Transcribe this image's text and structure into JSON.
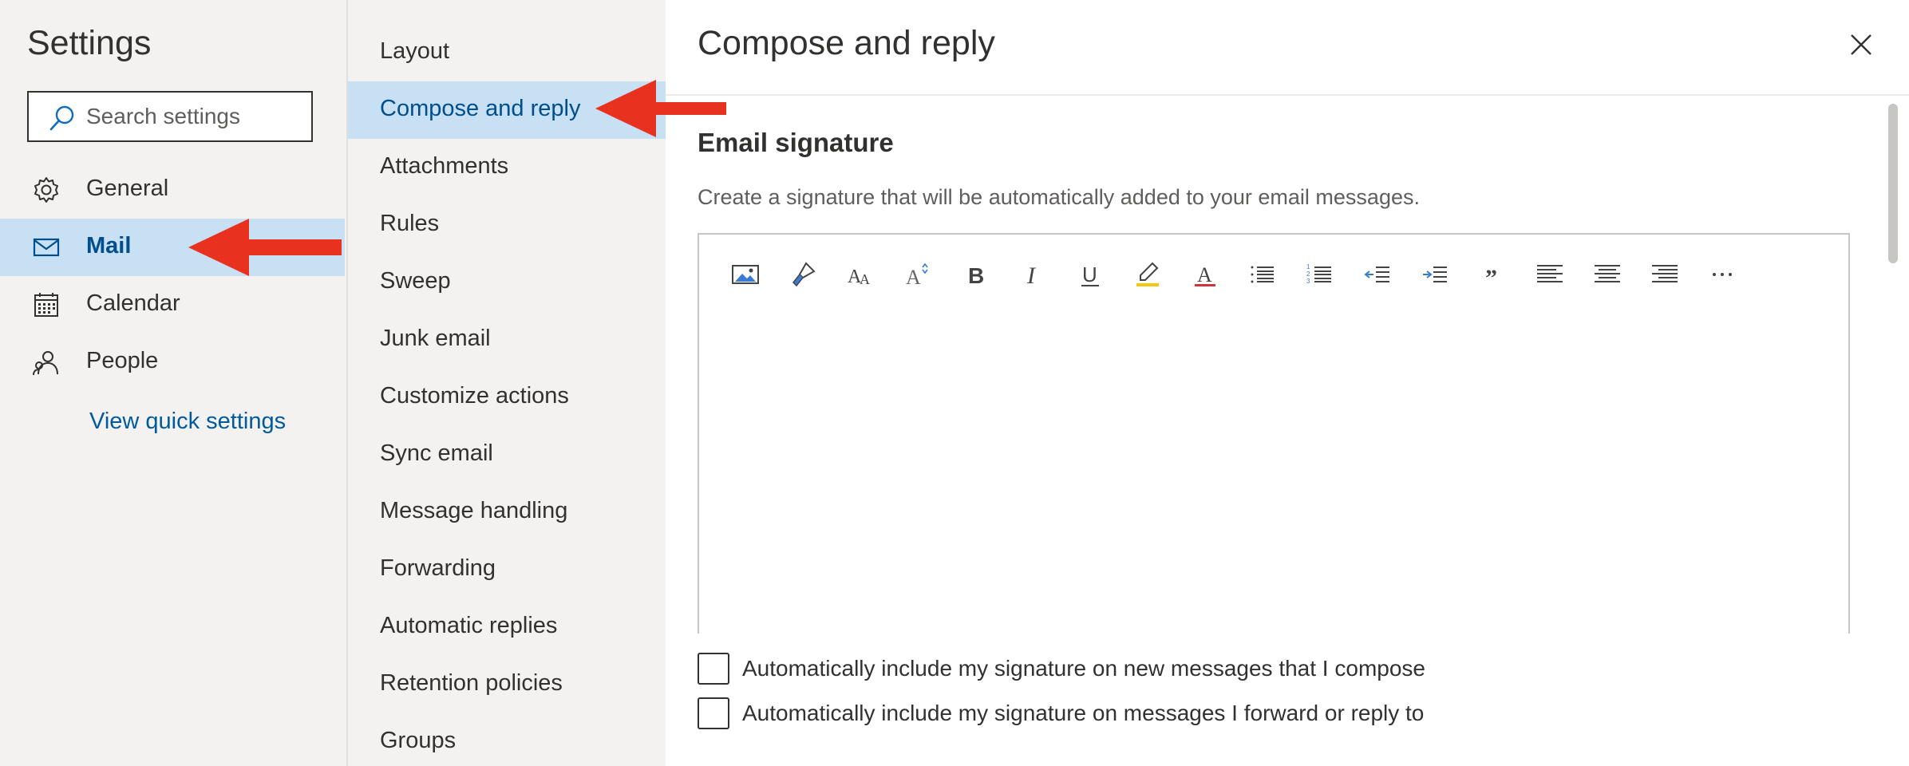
{
  "settings": {
    "title": "Settings",
    "search_placeholder": "Search settings",
    "nav": [
      {
        "label": "General",
        "icon": "gear-icon"
      },
      {
        "label": "Mail",
        "icon": "mail-icon"
      },
      {
        "label": "Calendar",
        "icon": "calendar-icon"
      },
      {
        "label": "People",
        "icon": "people-icon"
      }
    ],
    "active_nav": "Mail",
    "quick_settings_link": "View quick settings"
  },
  "mail_menu": {
    "items": [
      "Layout",
      "Compose and reply",
      "Attachments",
      "Rules",
      "Sweep",
      "Junk email",
      "Customize actions",
      "Sync email",
      "Message handling",
      "Forwarding",
      "Automatic replies",
      "Retention policies",
      "Groups"
    ],
    "active_item": "Compose and reply"
  },
  "content": {
    "title": "Compose and reply",
    "section_title": "Email signature",
    "section_description": "Create a signature that will be automatically added to your email messages.",
    "toolbar_icons": [
      "insert-picture-icon",
      "format-painter-icon",
      "font-icon",
      "font-size-icon",
      "bold-icon",
      "italic-icon",
      "underline-icon",
      "highlight-icon",
      "font-color-icon",
      "bullets-icon",
      "numbering-icon",
      "decrease-indent-icon",
      "increase-indent-icon",
      "quote-icon",
      "align-left-icon",
      "align-center-icon",
      "align-right-icon",
      "more-options-icon"
    ],
    "checkboxes": [
      {
        "label": "Automatically include my signature on new messages that I compose",
        "checked": false
      },
      {
        "label": "Automatically include my signature on messages I forward or reply to",
        "checked": false
      }
    ]
  },
  "colors": {
    "accent": "#004e8c",
    "selection": "#c7e0f4",
    "annotation_arrow": "#e8321f"
  }
}
